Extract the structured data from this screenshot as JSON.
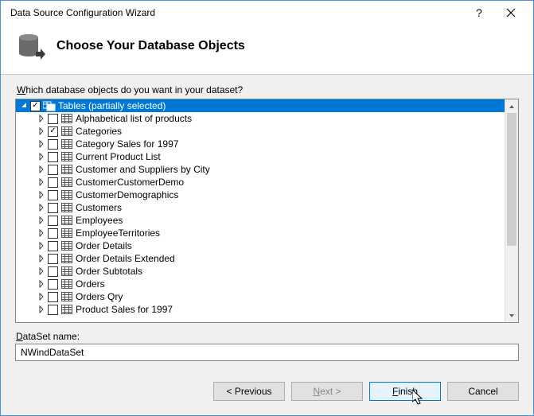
{
  "window": {
    "title": "Data Source Configuration Wizard"
  },
  "header": {
    "heading": "Choose Your Database Objects"
  },
  "prompt": {
    "prefix": "W",
    "rest": "hich database objects do you want in your dataset?"
  },
  "tree": {
    "root": {
      "label": "Tables (partially selected)",
      "state": "partial"
    },
    "items": [
      {
        "label": "Alphabetical list of products",
        "checked": false
      },
      {
        "label": "Categories",
        "checked": true
      },
      {
        "label": "Category Sales for 1997",
        "checked": false
      },
      {
        "label": "Current Product List",
        "checked": false
      },
      {
        "label": "Customer and Suppliers by City",
        "checked": false
      },
      {
        "label": "CustomerCustomerDemo",
        "checked": false
      },
      {
        "label": "CustomerDemographics",
        "checked": false
      },
      {
        "label": "Customers",
        "checked": false
      },
      {
        "label": "Employees",
        "checked": false
      },
      {
        "label": "EmployeeTerritories",
        "checked": false
      },
      {
        "label": "Order Details",
        "checked": false
      },
      {
        "label": "Order Details Extended",
        "checked": false
      },
      {
        "label": "Order Subtotals",
        "checked": false
      },
      {
        "label": "Orders",
        "checked": false
      },
      {
        "label": "Orders Qry",
        "checked": false
      },
      {
        "label": "Product Sales for 1997",
        "checked": false
      }
    ]
  },
  "dataset": {
    "label_prefix": "D",
    "label_rest": "ataSet name:",
    "value": "NWindDataSet"
  },
  "buttons": {
    "previous": "< Previous",
    "next_prefix": "N",
    "next_rest": "ext >",
    "finish_prefix": "F",
    "finish_rest": "inish",
    "cancel": "Cancel"
  }
}
